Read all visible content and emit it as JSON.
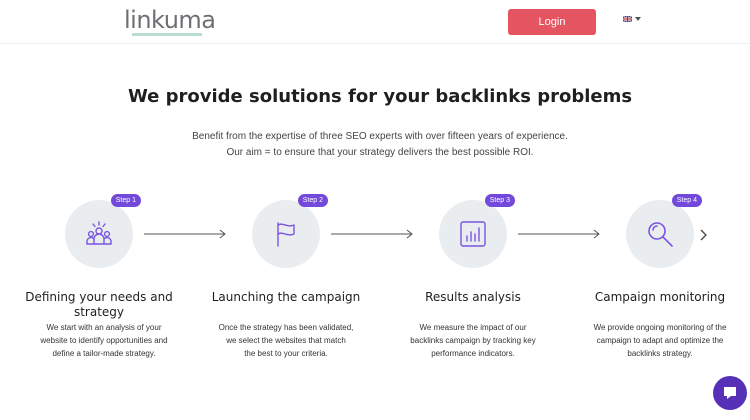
{
  "header": {
    "logo_text": "linkuma",
    "login_label": "Login",
    "language": {
      "selected": "English",
      "icon": "uk-flag-icon"
    }
  },
  "main": {
    "title": "We provide solutions for your backlinks problems",
    "subtitle_line1": "Benefit from the expertise of three SEO experts with over fifteen years of experience.",
    "subtitle_line2": "Our aim = to ensure that your strategy delivers the best possible ROI.",
    "steps": [
      {
        "badge": "Step 1",
        "icon": "team-icon",
        "title": "Defining your needs and strategy",
        "desc_lines": [
          "We start with an analysis of your",
          "website to identify opportunities and",
          "define a tailor-made strategy."
        ]
      },
      {
        "badge": "Step 2",
        "icon": "flag-icon",
        "title": "Launching the campaign",
        "desc_lines": [
          "Once the strategy has been validated,",
          "we select the websites that match",
          "the best to your criteria."
        ]
      },
      {
        "badge": "Step 3",
        "icon": "bar-chart-icon",
        "title": "Results analysis",
        "desc_lines": [
          "We measure the impact of our",
          "backlinks campaign by tracking key",
          "performance indicators."
        ]
      },
      {
        "badge": "Step 4",
        "icon": "magnifier-icon",
        "title": "Campaign monitoring",
        "desc_lines": [
          "We provide ongoing monitoring of the",
          "campaign to adapt and optimize the",
          "backlinks strategy."
        ]
      }
    ]
  },
  "colors": {
    "accent_red": "#e55561",
    "badge_purple": "#7349dc",
    "chat_purple": "#5631b8",
    "icon_purple": "#7b55e0",
    "circle_grey": "#eaedf0"
  },
  "chat": {
    "icon": "chat-bubble-icon"
  }
}
